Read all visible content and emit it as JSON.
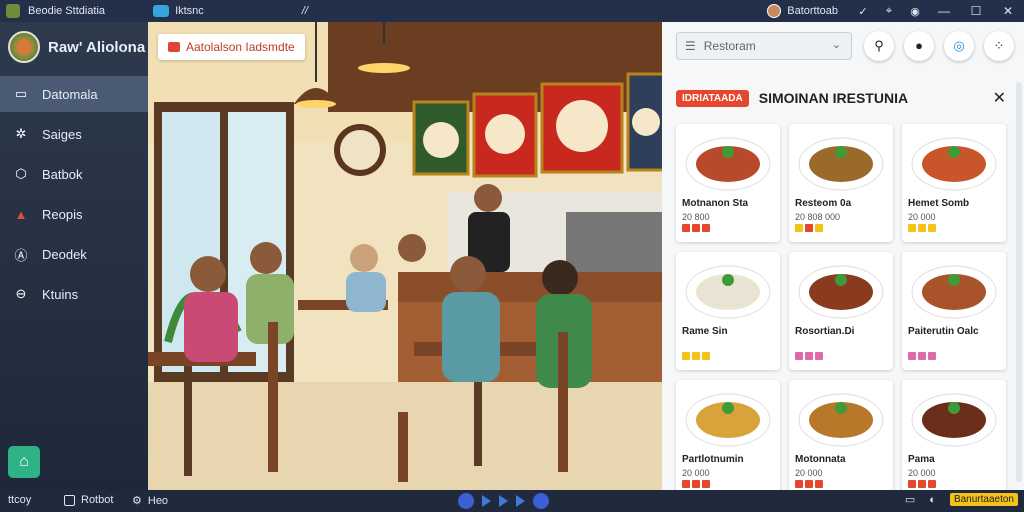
{
  "titlebar": {
    "tab_label": "Iktsnc",
    "path_hint": "//",
    "user_name": "Batorttoab",
    "app_name": "Beodie Sttdiatia"
  },
  "sidebar": {
    "title": "Raw' Aliolona",
    "items": [
      {
        "label": "Datomala",
        "icon": "menu-card-icon",
        "active": true
      },
      {
        "label": "Saiges",
        "icon": "settings-icon",
        "active": false
      },
      {
        "label": "Batbok",
        "icon": "hexagon-icon",
        "active": false
      },
      {
        "label": "Reopis",
        "icon": "alert-icon",
        "active": false
      },
      {
        "label": "Deodek",
        "icon": "profile-icon",
        "active": false
      },
      {
        "label": "Ktuins",
        "icon": "kitchen-icon",
        "active": false
      }
    ]
  },
  "scene": {
    "label": "Aatolalson Iadsmdte"
  },
  "panel": {
    "dropdown": {
      "value": "Restoram"
    },
    "badge": "IDRIATAADA",
    "restaurant_name": "SIMOINAN IRESTUNIA",
    "items": [
      {
        "name": "Motnanon Sta",
        "price": "20 800"
      },
      {
        "name": "Resteom 0a",
        "price": "20 808 000"
      },
      {
        "name": "Hemet Somb",
        "price": "20 000"
      },
      {
        "name": "Rame Sin",
        "price": ""
      },
      {
        "name": "Rosortian.Di",
        "price": ""
      },
      {
        "name": "Paiterutin Oalc",
        "price": ""
      },
      {
        "name": "Partlotnumin",
        "price": "20 000"
      },
      {
        "name": "Motonnata",
        "price": "20 000"
      },
      {
        "name": "Pama",
        "price": "20 000"
      }
    ]
  },
  "taskbar": {
    "left_label": "ttcoy",
    "btn1": "Rotbot",
    "btn2": "Heo",
    "right_badge": "Banurtaaeton"
  },
  "colors": {
    "accent_red": "#e4472f",
    "sidebar_bg": "#2d3a4d",
    "home_green": "#2fb386"
  }
}
